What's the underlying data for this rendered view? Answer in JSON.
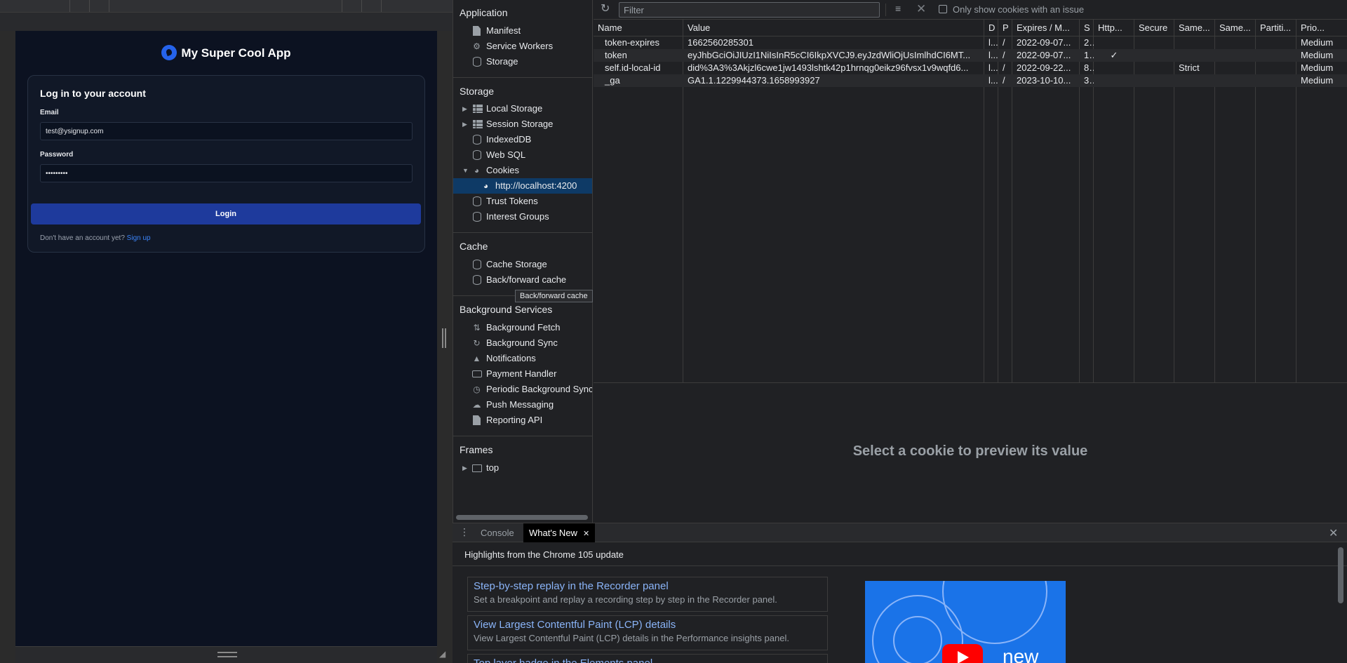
{
  "app": {
    "title": "My Super Cool App",
    "card_title": "Log in to your account",
    "email_label": "Email",
    "email_value": "test@ysignup.com",
    "password_label": "Password",
    "password_value": "•••••••••",
    "login_label": "Login",
    "no_account_text": "Don't have an account yet?",
    "signup_link": "Sign up"
  },
  "sidebar": {
    "application": {
      "header": "Application",
      "items": [
        {
          "label": "Manifest",
          "icon": "file-icon"
        },
        {
          "label": "Service Workers",
          "icon": "gear-icon"
        },
        {
          "label": "Storage",
          "icon": "database-icon"
        }
      ]
    },
    "storage": {
      "header": "Storage",
      "items": [
        {
          "label": "Local Storage",
          "icon": "table-icon"
        },
        {
          "label": "Session Storage",
          "icon": "table-icon"
        },
        {
          "label": "IndexedDB",
          "icon": "database-icon"
        },
        {
          "label": "Web SQL",
          "icon": "database-icon"
        },
        {
          "label": "Cookies",
          "icon": "cookie-icon"
        },
        {
          "label": "http://localhost:4200",
          "icon": "cookie-icon"
        },
        {
          "label": "Trust Tokens",
          "icon": "database-icon"
        },
        {
          "label": "Interest Groups",
          "icon": "database-icon"
        }
      ]
    },
    "cache": {
      "header": "Cache",
      "items": [
        {
          "label": "Cache Storage",
          "icon": "database-icon"
        },
        {
          "label": "Back/forward cache",
          "icon": "database-icon"
        }
      ]
    },
    "background": {
      "header": "Background Services",
      "items": [
        {
          "label": "Background Fetch",
          "icon": "arrows-up-down-icon"
        },
        {
          "label": "Background Sync",
          "icon": "sync-icon"
        },
        {
          "label": "Notifications",
          "icon": "bell-icon"
        },
        {
          "label": "Payment Handler",
          "icon": "credit-card-icon"
        },
        {
          "label": "Periodic Background Sync",
          "icon": "clock-icon"
        },
        {
          "label": "Push Messaging",
          "icon": "cloud-icon"
        },
        {
          "label": "Reporting API",
          "icon": "file-icon"
        }
      ]
    },
    "frames": {
      "header": "Frames",
      "items": [
        {
          "label": "top",
          "icon": "frame-icon"
        }
      ]
    },
    "tooltip": "Back/forward cache"
  },
  "toolbar": {
    "filter_placeholder": "Filter",
    "issue_label": "Only show cookies with an issue"
  },
  "cookies": {
    "columns": [
      "Name",
      "Value",
      "D",
      "P",
      "Expires / M...",
      "S",
      "Http...",
      "Secure",
      "Same...",
      "Same...",
      "Partiti...",
      "Prio..."
    ],
    "rows": [
      [
        "token-expires",
        "1662560285301",
        "l...",
        "/",
        "2022-09-07...",
        "2...",
        "",
        "",
        "",
        "",
        "",
        "Medium"
      ],
      [
        "token",
        "eyJhbGciOiJIUzI1NiIsInR5cCI6IkpXVCJ9.eyJzdWliOjUsImlhdCI6MT...",
        "l...",
        "/",
        "2022-09-07...",
        "1...",
        "✓",
        "",
        "",
        "",
        "",
        "Medium"
      ],
      [
        "self.id-local-id",
        "did%3A3%3Akjzl6cwe1jw1493lshtk42p1hrnqg0eikz96fvsx1v9wqfd6...",
        "l...",
        "/",
        "2022-09-22...",
        "8...",
        "",
        "",
        "Strict",
        "",
        "",
        "Medium"
      ],
      [
        "_ga",
        "GA1.1.1229944373.1658993927",
        "l...",
        "/",
        "2023-10-10...",
        "3...",
        "",
        "",
        "",
        "",
        "",
        "Medium"
      ]
    ],
    "preview_message": "Select a cookie to preview its value"
  },
  "drawer": {
    "tabs": [
      {
        "label": "Console"
      },
      {
        "label": "What's New"
      }
    ],
    "heading": "Highlights from the Chrome 105 update",
    "cards": [
      {
        "title": "Step-by-step replay in the Recorder panel",
        "desc": "Set a breakpoint and replay a recording step by step in the Recorder panel."
      },
      {
        "title": "View Largest Contentful Paint (LCP) details",
        "desc": "View Largest Contentful Paint (LCP) details in the Performance insights panel."
      },
      {
        "title": "Top layer badge in the Elements panel",
        "desc": ""
      }
    ],
    "promo_text": "new"
  }
}
